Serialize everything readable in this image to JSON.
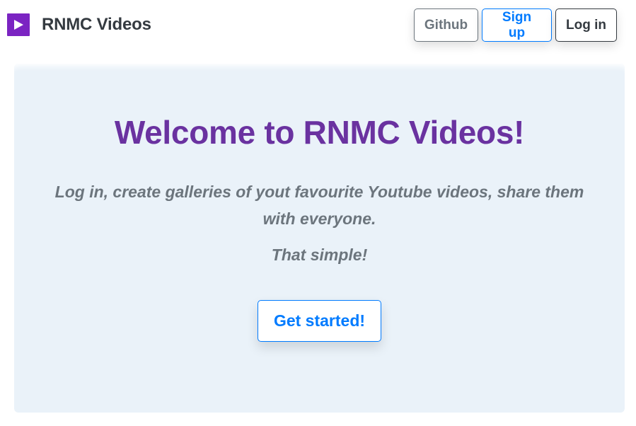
{
  "navbar": {
    "brand_name": "RNMC Videos",
    "brand_icon": "play-icon",
    "buttons": {
      "github_label": "Github",
      "signup_label": "Sign up",
      "login_label": "Log in"
    }
  },
  "hero": {
    "title": "Welcome to RNMC Videos!",
    "lead": "Log in, create galleries of yout favourite Youtube videos, share them with everyone.",
    "sub": "That simple!",
    "cta_label": "Get started!"
  },
  "colors": {
    "brand_purple": "#7b24c2",
    "title_purple": "#6a32a0",
    "primary_blue": "#007bff",
    "secondary_gray": "#6c757d",
    "dark": "#343a40",
    "jumbotron_bg": "#eaf2f9"
  }
}
